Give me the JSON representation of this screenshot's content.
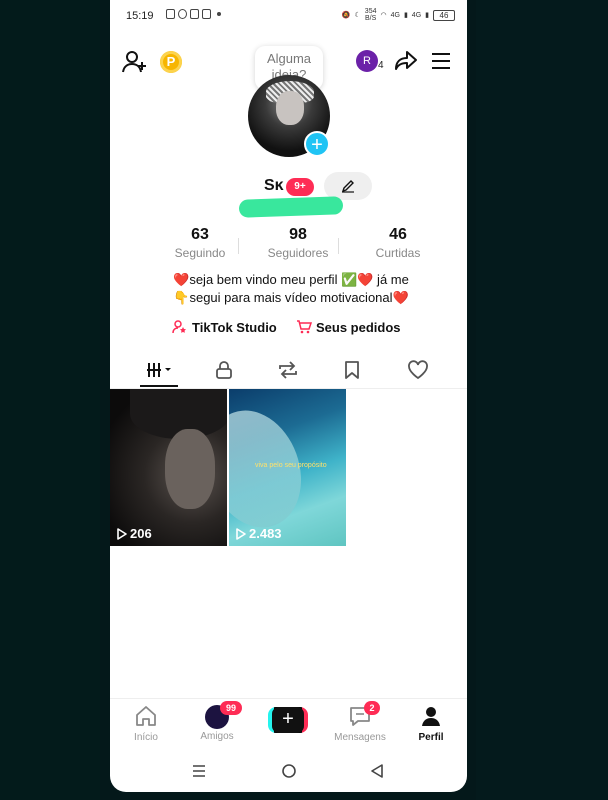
{
  "status_bar": {
    "time": "15:19",
    "network_speed": "354",
    "network_unit": "B/S",
    "sig1": "4G",
    "sig2": "4G",
    "battery": "46"
  },
  "topbar": {
    "idea_bubble": "Alguma ideia?",
    "account_initial": "R",
    "account_count": "4",
    "coin_label": "P"
  },
  "profile": {
    "username": "Sĸ",
    "notification_badge": "9+",
    "stats": [
      {
        "value": "63",
        "label": "Seguindo"
      },
      {
        "value": "98",
        "label": "Seguidores"
      },
      {
        "value": "46",
        "label": "Curtidas"
      }
    ],
    "bio_line1": "❤️seja bem vindo meu perfil ✅❤️ já me",
    "bio_line2": "👇segui para mais vídeo motivacional❤️",
    "link_studio": "TikTok Studio",
    "link_orders": "Seus pedidos"
  },
  "videos": [
    {
      "views": "206"
    },
    {
      "views": "2.483",
      "caption": "viva pelo seu propósito"
    }
  ],
  "bottom_nav": {
    "home": "Início",
    "friends": "Amigos",
    "friends_badge": "99",
    "messages": "Mensagens",
    "messages_badge": "2",
    "profile": "Perfil"
  },
  "colors": {
    "accent": "#fe2c55",
    "cyan": "#25f4ee",
    "add_blue": "#20c4f4",
    "redaction_green": "#39e79d"
  }
}
